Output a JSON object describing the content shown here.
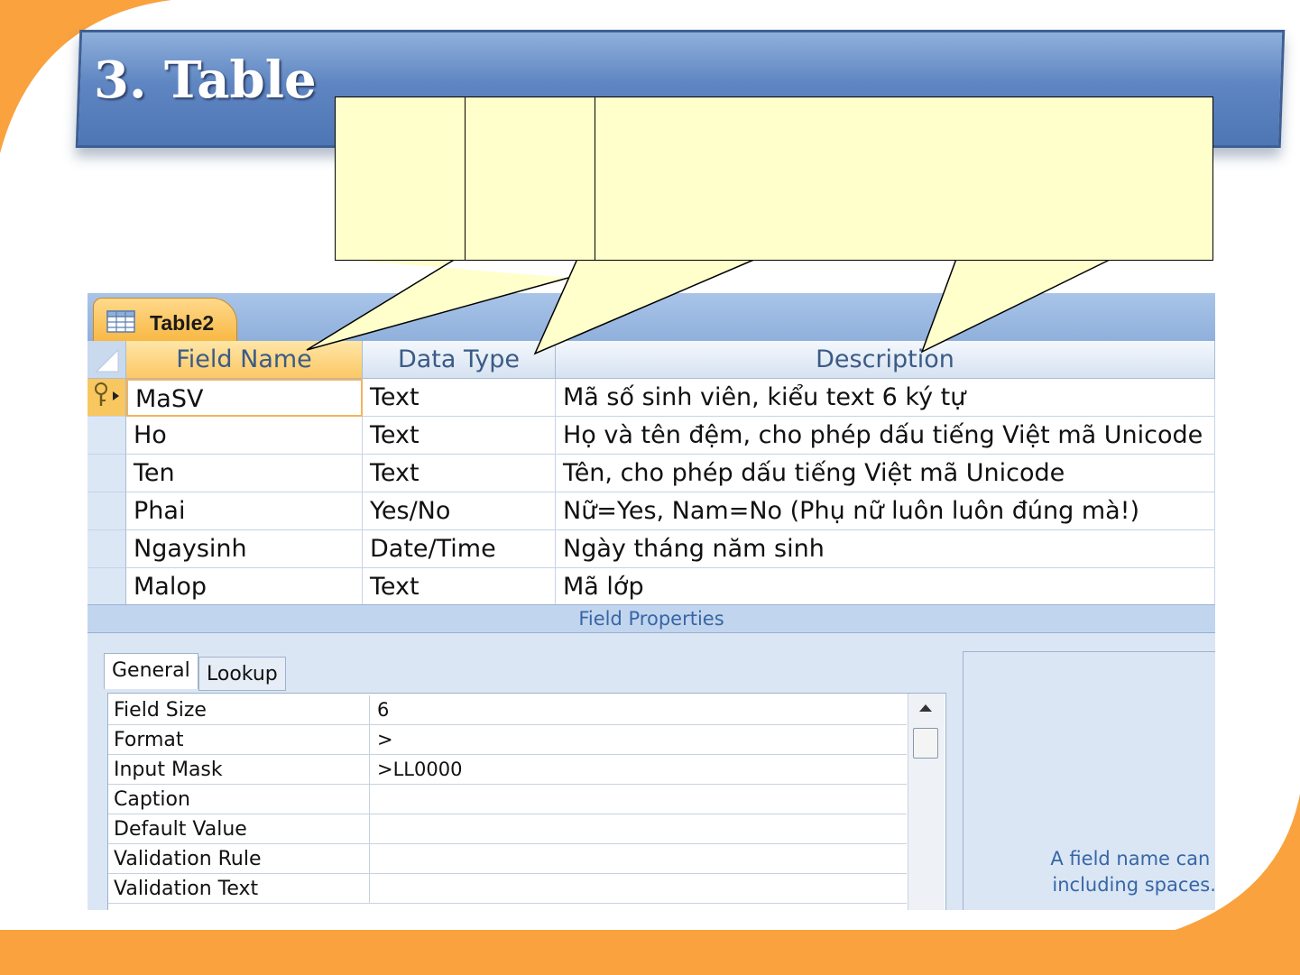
{
  "slide": {
    "title": "3. Table",
    "colors": {
      "frame_orange": "#f9a23e",
      "banner_blue": "#5f86c2",
      "callout_fill": "#ffffcc"
    }
  },
  "window": {
    "tab_title": "Table2",
    "tab_icon": "table-grid-icon"
  },
  "grid": {
    "headers": [
      "Field Name",
      "Data Type",
      "Description"
    ],
    "rows": [
      {
        "field": "MaSV",
        "type": "Text",
        "desc": "Mã số sinh viên, kiểu text 6 ký tự",
        "primary_key": true
      },
      {
        "field": "Ho",
        "type": "Text",
        "desc": "Họ và tên đệm, cho phép dấu tiếng Việt mã Unicode"
      },
      {
        "field": "Ten",
        "type": "Text",
        "desc": "Tên, cho phép dấu tiếng Việt mã Unicode"
      },
      {
        "field": "Phai",
        "type": "Yes/No",
        "desc": "Nữ=Yes, Nam=No (Phụ nữ luôn luôn đúng mà!)"
      },
      {
        "field": "Ngaysinh",
        "type": "Date/Time",
        "desc": "Ngày tháng năm sinh"
      },
      {
        "field": "Malop",
        "type": "Text",
        "desc": "Mã lớp"
      }
    ]
  },
  "field_properties": {
    "bar_label": "Field Properties",
    "tabs": [
      "General",
      "Lookup"
    ],
    "rows": [
      {
        "label": "Field Size",
        "value": "6"
      },
      {
        "label": "Format",
        "value": ">"
      },
      {
        "label": "Input Mask",
        "value": ">LL0000"
      },
      {
        "label": "Caption",
        "value": ""
      },
      {
        "label": "Default Value",
        "value": ""
      },
      {
        "label": "Validation Rule",
        "value": ""
      },
      {
        "label": "Validation Text",
        "value": ""
      }
    ],
    "help_text": "A field name can be up\nincluding spaces.  Pres"
  }
}
